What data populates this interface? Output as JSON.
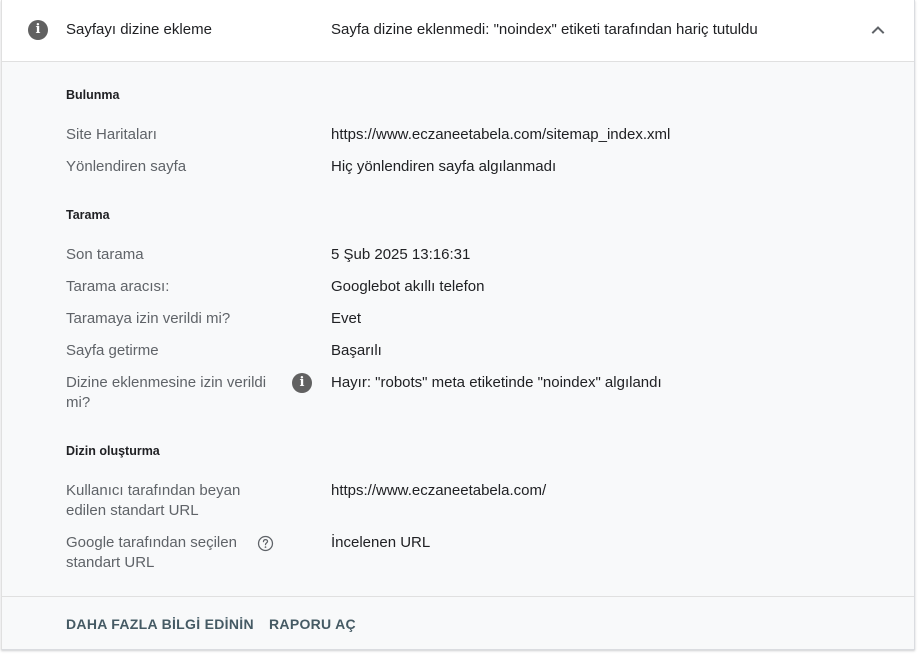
{
  "header": {
    "title": "Sayfayı dizine ekleme",
    "status": "Sayfa dizine eklenmedi: \"noindex\" etiketi tarafından hariç tutuldu",
    "icon": "info-icon",
    "toggle_icon": "chevron-up-icon"
  },
  "sections": {
    "discovery": {
      "title": "Bulunma",
      "rows": [
        {
          "label": "Site Haritaları",
          "value": "https://www.eczaneetabela.com/sitemap_index.xml"
        },
        {
          "label": "Yönlendiren sayfa",
          "value": "Hiç yönlendiren sayfa algılanmadı"
        }
      ]
    },
    "crawl": {
      "title": "Tarama",
      "rows": [
        {
          "label": "Son tarama",
          "value": "5 Şub 2025 13:16:31"
        },
        {
          "label": "Tarama aracısı:",
          "value": "Googlebot akıllı telefon"
        },
        {
          "label": "Taramaya izin verildi mi?",
          "value": "Evet"
        },
        {
          "label": "Sayfa getirme",
          "value": "Başarılı"
        },
        {
          "label": "Dizine eklenmesine izin verildi mi?",
          "value": "Hayır: \"robots\" meta etiketinde \"noindex\" algılandı",
          "icon": "info-icon"
        }
      ]
    },
    "indexing": {
      "title": "Dizin oluşturma",
      "rows": [
        {
          "label": "Kullanıcı tarafından beyan edilen standart URL",
          "value": "https://www.eczaneetabela.com/"
        },
        {
          "label": "Google tarafından seçilen standart URL",
          "value": "İncelenen URL",
          "icon": "help-icon"
        }
      ]
    }
  },
  "footer": {
    "learn_more": "DAHA FAZLA BİLGİ EDİNİN",
    "open_report": "RAPORU AÇ"
  },
  "colors": {
    "panel_bg": "#f8f9fa",
    "label": "#5f6368",
    "text": "#202124",
    "link": "#455a64",
    "icon": "#616161"
  }
}
